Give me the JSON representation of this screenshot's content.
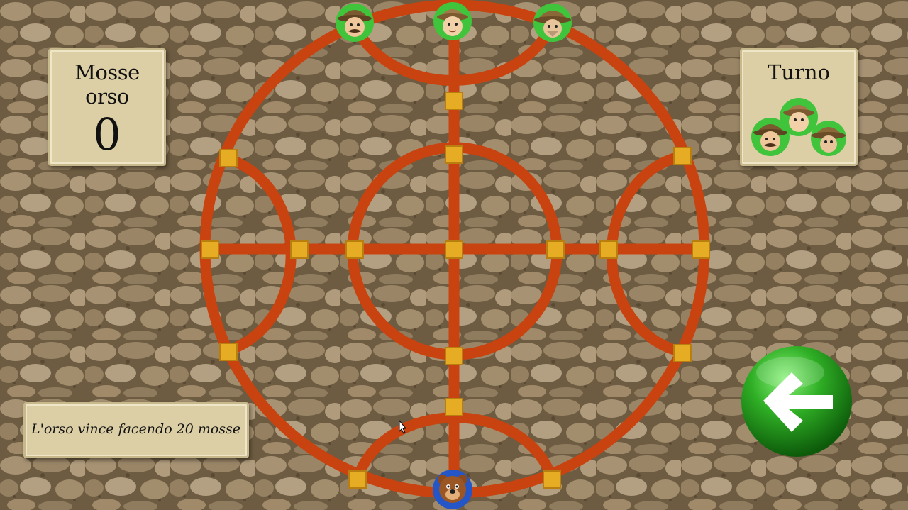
{
  "moves_panel": {
    "title": "Mosse orso",
    "value": "0"
  },
  "turn_panel": {
    "title": "Turno",
    "current_player": "hunters"
  },
  "info": {
    "text": "L'orso vince facendo 20 mosse"
  },
  "colors": {
    "track": "#c8430f",
    "node": "#e6ac24",
    "hunter_ring": "#3fc43c",
    "bear_ring": "#2456c8",
    "panel": "#dccfa6"
  },
  "pieces": [
    {
      "type": "hunter",
      "name": "hunter-1",
      "node": "top-left"
    },
    {
      "type": "hunter",
      "name": "hunter-2",
      "node": "top-center"
    },
    {
      "type": "hunter",
      "name": "hunter-3",
      "node": "top-right"
    },
    {
      "type": "bear",
      "name": "bear",
      "node": "bottom-center"
    }
  ],
  "back_button": {
    "icon": "back-arrow-icon"
  }
}
